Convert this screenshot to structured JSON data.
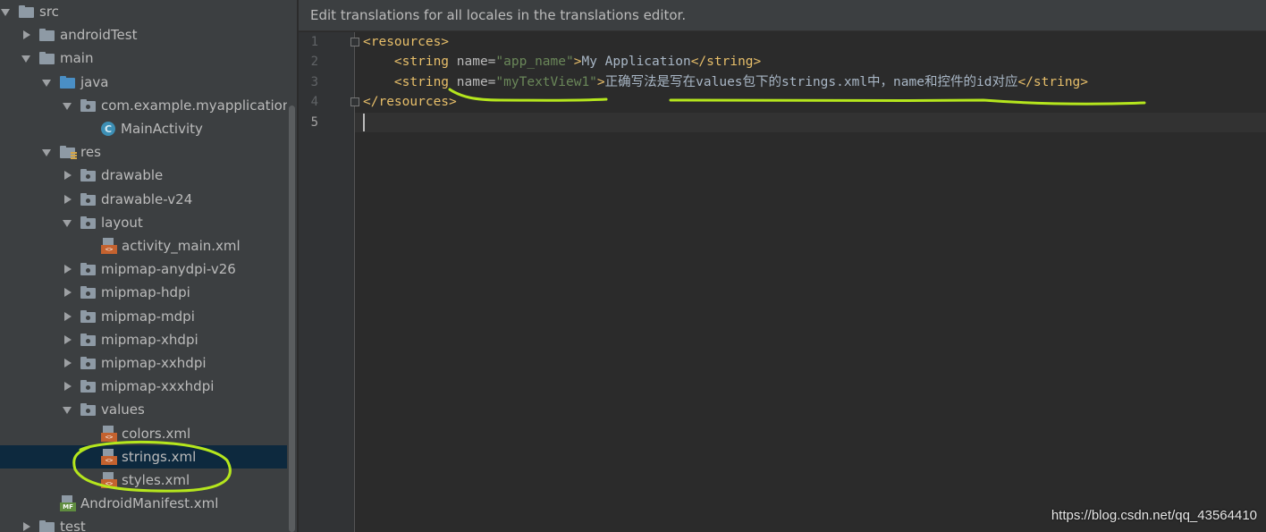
{
  "tree": {
    "items": [
      {
        "label": "src",
        "arrow": "down",
        "icon": "folder"
      },
      {
        "label": "androidTest",
        "arrow": "right",
        "icon": "folder"
      },
      {
        "label": "main",
        "arrow": "down",
        "icon": "folder"
      },
      {
        "label": "java",
        "arrow": "down",
        "icon": "source-folder"
      },
      {
        "label": "com.example.myapplication",
        "arrow": "down",
        "icon": "package"
      },
      {
        "label": "MainActivity",
        "arrow": "none",
        "icon": "class"
      },
      {
        "label": "res",
        "arrow": "down",
        "icon": "resource-folder"
      },
      {
        "label": "drawable",
        "arrow": "right",
        "icon": "package"
      },
      {
        "label": "drawable-v24",
        "arrow": "right",
        "icon": "package"
      },
      {
        "label": "layout",
        "arrow": "down",
        "icon": "package"
      },
      {
        "label": "activity_main.xml",
        "arrow": "none",
        "icon": "xml-file"
      },
      {
        "label": "mipmap-anydpi-v26",
        "arrow": "right",
        "icon": "package"
      },
      {
        "label": "mipmap-hdpi",
        "arrow": "right",
        "icon": "package"
      },
      {
        "label": "mipmap-mdpi",
        "arrow": "right",
        "icon": "package"
      },
      {
        "label": "mipmap-xhdpi",
        "arrow": "right",
        "icon": "package"
      },
      {
        "label": "mipmap-xxhdpi",
        "arrow": "right",
        "icon": "package"
      },
      {
        "label": "mipmap-xxxhdpi",
        "arrow": "right",
        "icon": "package"
      },
      {
        "label": "values",
        "arrow": "down",
        "icon": "package"
      },
      {
        "label": "colors.xml",
        "arrow": "none",
        "icon": "xml-file"
      },
      {
        "label": "strings.xml",
        "arrow": "none",
        "icon": "xml-file",
        "selected": true
      },
      {
        "label": "styles.xml",
        "arrow": "none",
        "icon": "xml-file"
      },
      {
        "label": "AndroidManifest.xml",
        "arrow": "none",
        "icon": "manifest-file"
      },
      {
        "label": "test",
        "arrow": "right",
        "icon": "folder"
      }
    ],
    "class_icon_letter": "C",
    "xml_badge": "<>",
    "mf_badge": "MF"
  },
  "editor": {
    "banner": "Edit translations for all locales in the translations editor.",
    "line_numbers": [
      "1",
      "2",
      "3",
      "4",
      "5"
    ],
    "lines": [
      [
        {
          "t": "<resources>",
          "c": "tag"
        }
      ],
      [
        {
          "t": "    ",
          "c": "text"
        },
        {
          "t": "<string ",
          "c": "tag"
        },
        {
          "t": "name=",
          "c": "attr"
        },
        {
          "t": "\"app_name\"",
          "c": "val"
        },
        {
          "t": ">",
          "c": "tag"
        },
        {
          "t": "My Application",
          "c": "text"
        },
        {
          "t": "</string>",
          "c": "tag"
        }
      ],
      [
        {
          "t": "    ",
          "c": "text"
        },
        {
          "t": "<string ",
          "c": "tag"
        },
        {
          "t": "name=",
          "c": "attr"
        },
        {
          "t": "\"myTextView1\"",
          "c": "val"
        },
        {
          "t": ">",
          "c": "tag"
        },
        {
          "t": "正确写法是写在values包下的strings.xml中，name和控件的id对应",
          "c": "text"
        },
        {
          "t": "</string>",
          "c": "tag"
        }
      ],
      [
        {
          "t": "</resources>",
          "c": "tag"
        }
      ],
      []
    ]
  },
  "watermark": "https://blog.csdn.net/qq_43564410",
  "colors": {
    "annotation": "#b5e61d",
    "tag": "#e8bf6a",
    "value": "#6a8759",
    "selection": "#0d293e"
  }
}
